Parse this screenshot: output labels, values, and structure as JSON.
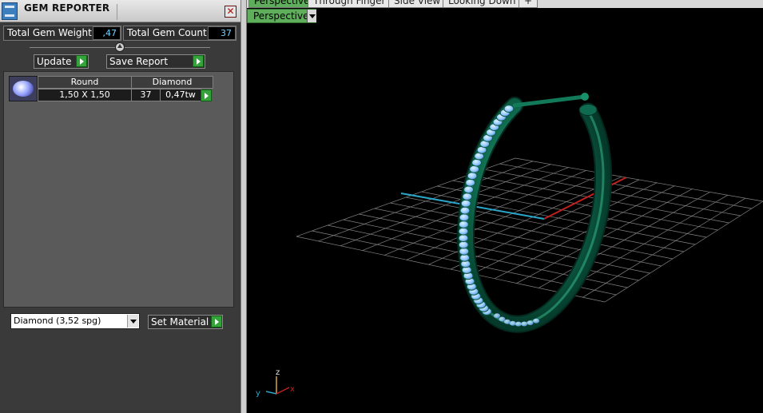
{
  "window": {
    "title": "GEM REPORTER",
    "close_symbol": "✕"
  },
  "totals": {
    "weight_label": "Total Gem Weight",
    "weight_value": ",47",
    "count_label": "Total Gem Count",
    "count_value": "37"
  },
  "actions": {
    "update_label": "Update",
    "save_report_label": "Save Report"
  },
  "gem_table": {
    "headers": {
      "shape": "Round",
      "material": "Diamond"
    },
    "row": {
      "size": "1,50 X 1,50",
      "count": "37",
      "weight": "0,47tw"
    }
  },
  "material": {
    "selected": "Diamond    (3,52 spg)",
    "set_label": "Set Material"
  },
  "viewport": {
    "tabs": [
      "Perspective",
      "Through Finger",
      "Side View",
      "Looking Down",
      "+"
    ],
    "view_dropdown": "Perspective",
    "axis_labels": {
      "z": "z",
      "y": "y",
      "x": "x"
    }
  },
  "colors": {
    "accent_green": "#5fae5b",
    "value_text": "#6fd3ff",
    "ring_green": "#0f6b4f",
    "gem_blue": "#8fc8ff",
    "grid": "#9a9a9a",
    "axis_x": "#c02020",
    "axis_y": "#2aa7c9"
  }
}
